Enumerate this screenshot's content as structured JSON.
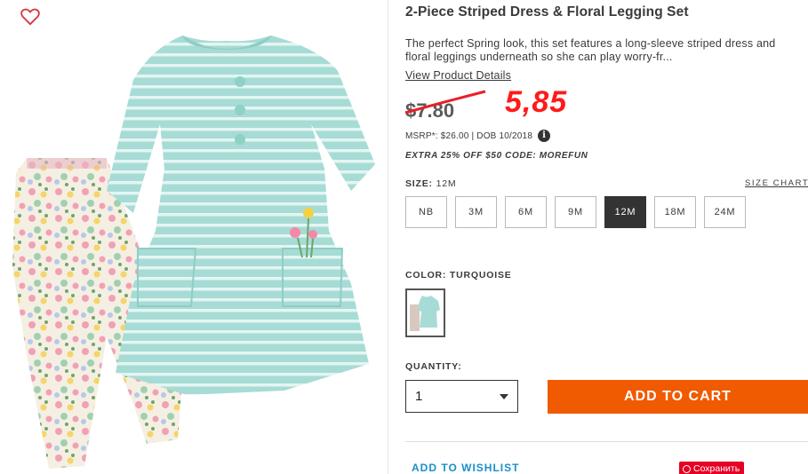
{
  "product": {
    "title": "2-Piece Striped Dress & Floral Legging Set",
    "description": "The perfect Spring look, this set features a long-sleeve striped dress and floral leggings underneath so she can play worry-fr...",
    "view_details_label": "View Product Details",
    "old_price": "$7.80",
    "new_price": "5,85",
    "msrp_text": "MSRP*: $26.00 | DOB 10/2018",
    "info_icon_glyph": "i",
    "promo_text": "EXTRA 25% OFF $50 CODE: MOREFUN"
  },
  "size": {
    "label": "SIZE:",
    "selected_value": "12M",
    "chart_label": "SIZE CHART",
    "options": [
      "NB",
      "3M",
      "6M",
      "9M",
      "12M",
      "18M",
      "24M"
    ],
    "selected_index": 4
  },
  "color": {
    "label": "COLOR: TURQUOISE"
  },
  "quantity": {
    "label": "QUANTITY:",
    "value": "1"
  },
  "actions": {
    "add_to_cart_label": "ADD TO CART",
    "wishlist_label": "ADD TO WISHLIST",
    "pinterest_label": "Сохранить"
  },
  "icons": {
    "favorite": "heart-icon",
    "dropdown": "chevron-down-icon",
    "pinterest": "pinterest-icon"
  },
  "colors": {
    "accent_orange": "#f05a00",
    "price_red": "#ff1a1a",
    "link_blue": "#1a8fc9",
    "dress_turquoise": "#a8ddd6",
    "selected_size_bg": "#333333"
  }
}
